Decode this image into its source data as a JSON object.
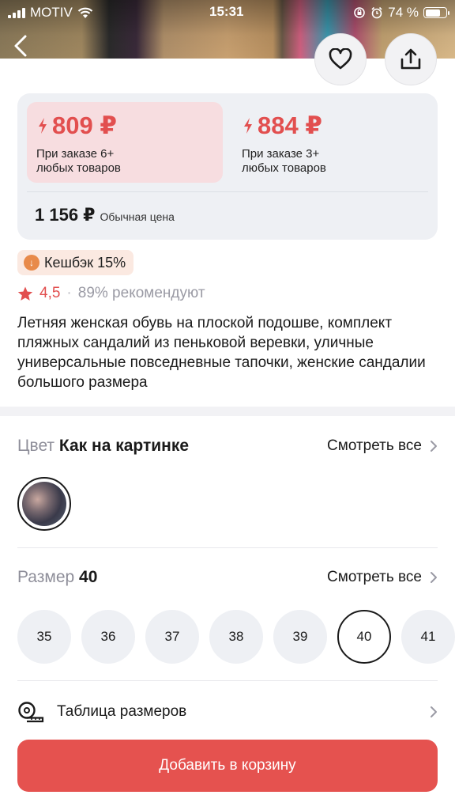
{
  "status_bar": {
    "carrier": "MOTIV",
    "time": "15:31",
    "battery": "74 %",
    "battery_level": 0.74
  },
  "header": {
    "back_icon": "chevron-left-icon",
    "favorite_icon": "heart-icon",
    "share_icon": "share-icon"
  },
  "prices": {
    "tiers": [
      {
        "amount": "809 ₽",
        "condition_line1": "При заказе 6+",
        "condition_line2": "любых товаров"
      },
      {
        "amount": "884 ₽",
        "condition_line1": "При заказе 3+",
        "condition_line2": "любых товаров"
      }
    ],
    "regular_value": "1 156 ₽",
    "regular_label": "Обычная цена",
    "accent_color": "#e24f4f"
  },
  "cashback": {
    "icon": "cashback-coin-icon",
    "text": "Кешбэк 15%"
  },
  "rating": {
    "score": "4,5",
    "separator": "·",
    "recommend": "89% рекомендуют"
  },
  "product": {
    "title": "Летняя женская обувь на плоской подошве, комплект пляжных сандалий из пеньковой веревки, уличные универсальные повседневные тапочки, женские сандалии большого размера"
  },
  "color": {
    "label": "Цвет",
    "value": "Как на картинке",
    "see_all": "Смотреть все"
  },
  "size": {
    "label": "Размер",
    "value": "40",
    "see_all": "Смотреть все",
    "options": [
      "35",
      "36",
      "37",
      "38",
      "39",
      "40",
      "41"
    ],
    "selected": "40"
  },
  "size_table": {
    "icon": "measuring-tape-icon",
    "label": "Таблица размеров"
  },
  "cart_button": {
    "label": "Добавить в корзину",
    "color": "#e5524f"
  }
}
